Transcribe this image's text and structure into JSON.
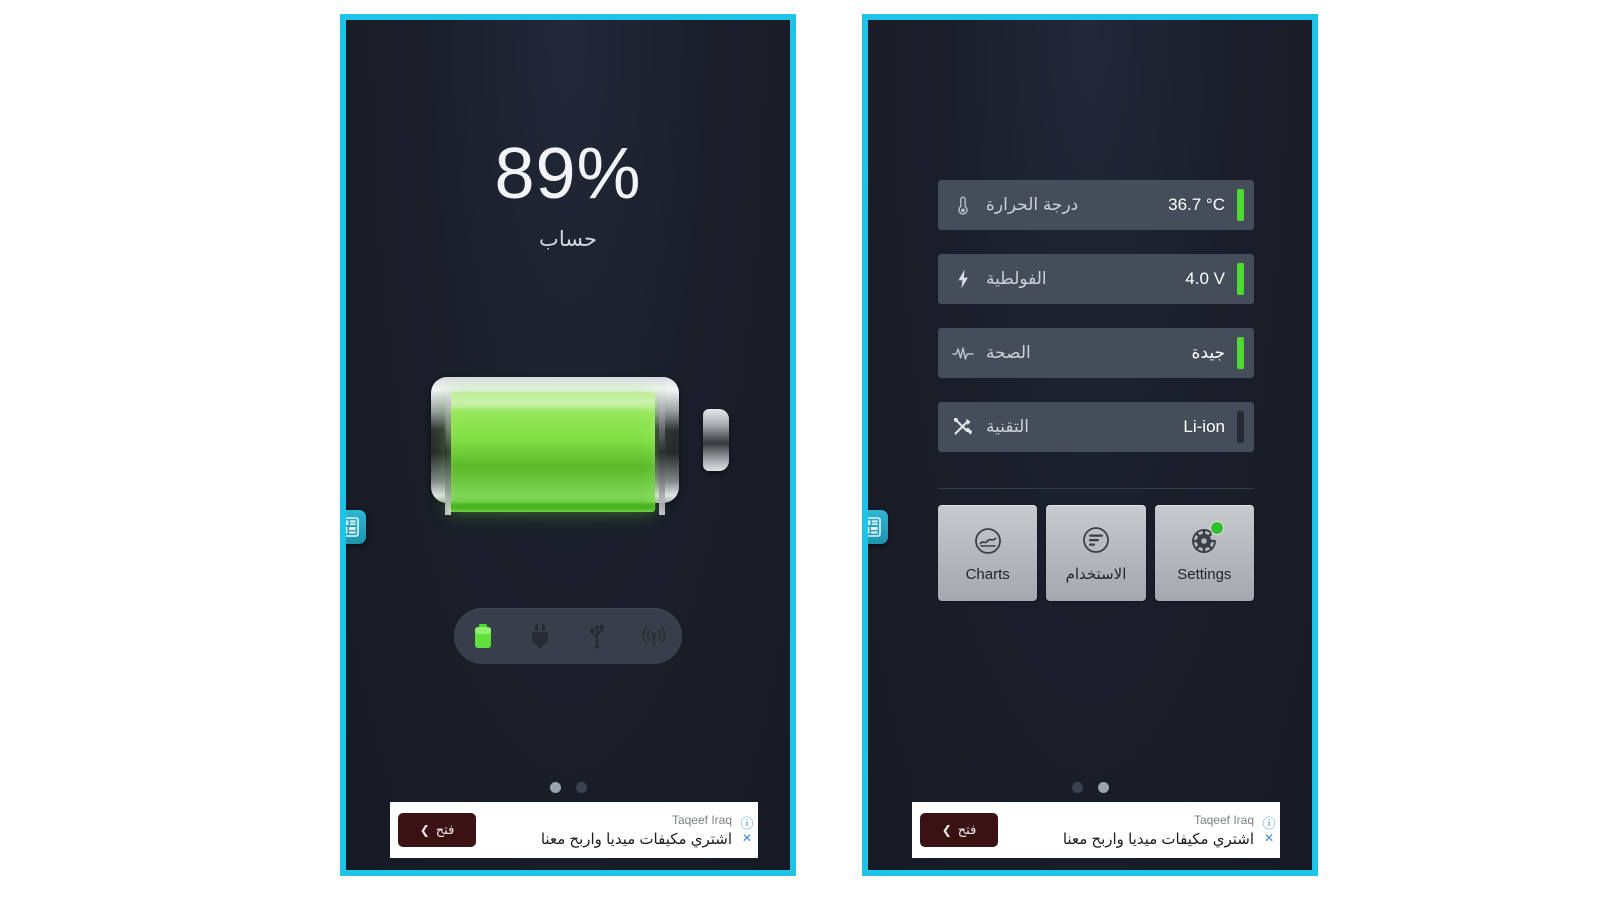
{
  "app": {
    "accent_border_color": "#1fc3e8",
    "screen_background": "#1a1f2b",
    "good_color": "#4ddb2f"
  },
  "left_panel": {
    "percentage": "89%",
    "status_label": "حساب",
    "battery_icon_name": "horizontal-battery-graphic",
    "status_icons": [
      {
        "name": "battery-icon",
        "active": true
      },
      {
        "name": "plug-icon",
        "active": false
      },
      {
        "name": "usb-icon",
        "active": false
      },
      {
        "name": "wireless-charging-icon",
        "active": false
      }
    ],
    "page_dots": {
      "count": 2,
      "active_index": 0
    },
    "side_icon_name": "dashboard-widget-icon"
  },
  "right_panel": {
    "rows": [
      {
        "icon": "thermometer-icon",
        "label": "درجة الحرارة",
        "value": "36.7 °C",
        "value_rtl": false,
        "bar": "good"
      },
      {
        "icon": "bolt-icon",
        "label": "الفولطية",
        "value": "4.0 V",
        "value_rtl": false,
        "bar": "good"
      },
      {
        "icon": "pulse-icon",
        "label": "الصحة",
        "value": "جيدة",
        "value_rtl": true,
        "bar": "good"
      },
      {
        "icon": "tools-icon",
        "label": "التقنية",
        "value": "Li-ion",
        "value_rtl": false,
        "bar": "dim"
      }
    ],
    "buttons": [
      {
        "icon": "charts-icon",
        "label": "Charts",
        "badge": false
      },
      {
        "icon": "usage-icon",
        "label": "الاستخدام",
        "badge": false
      },
      {
        "icon": "settings-gear-icon",
        "label": "Settings",
        "badge": true
      }
    ],
    "page_dots": {
      "count": 2,
      "active_index": 1
    },
    "side_icon_name": "dashboard-widget-icon"
  },
  "ad": {
    "advertiser": "Taqeef Iraq",
    "copy": "اشتري مكيفات ميديا واربح معنا",
    "cta_label": "فتح",
    "cta_chevron": "❮",
    "info_glyph": "ⓘ",
    "close_glyph": "✕"
  }
}
